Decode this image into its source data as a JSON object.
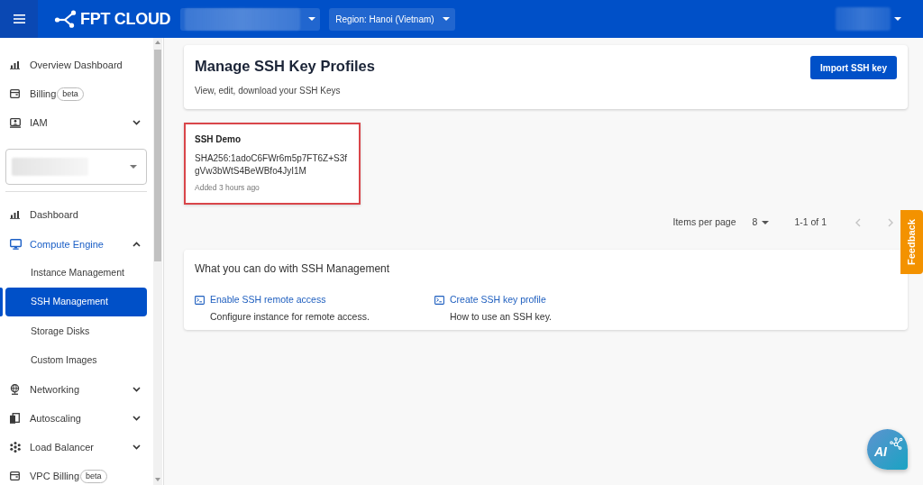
{
  "header": {
    "logo": "FPT CLOUD",
    "region": "Region: Hanoi (Vietnam)"
  },
  "sidebar": {
    "items": [
      {
        "kind": "link",
        "label": "Overview Dashboard",
        "selected": false
      },
      {
        "kind": "link",
        "label": "Billing",
        "badge": "beta",
        "selected": false
      },
      {
        "kind": "group",
        "label": "IAM",
        "expanded": false
      },
      {
        "kind": "select"
      },
      {
        "kind": "link",
        "label": "Dashboard",
        "selected": false
      },
      {
        "kind": "group",
        "label": "Compute Engine",
        "expanded": true,
        "children": [
          {
            "label": "Instance Management",
            "selected": false
          },
          {
            "label": "SSH Management",
            "selected": true
          },
          {
            "label": "Storage Disks",
            "selected": false
          },
          {
            "label": "Custom Images",
            "selected": false
          }
        ]
      },
      {
        "kind": "group",
        "label": "Networking",
        "expanded": false
      },
      {
        "kind": "group",
        "label": "Autoscaling",
        "expanded": false
      },
      {
        "kind": "group",
        "label": "Load Balancer",
        "expanded": false
      },
      {
        "kind": "link",
        "label": "VPC Billing",
        "badge": "beta",
        "selected": false
      }
    ]
  },
  "page_header": {
    "title": "Manage SSH Key Profiles",
    "subtitle": "View, edit, download your SSH Keys",
    "button": "Import SSH key"
  },
  "ssh_keys": [
    {
      "name": "SSH Demo",
      "fingerprint": "SHA256:1adoC6FWr6m5p7FT6Z+S3fgVw3bWtS4BeWBfo4JyI1M",
      "added": "Added 3 hours ago",
      "highlighted": true
    }
  ],
  "pagination": {
    "items_per_page_label": "Items per page",
    "page_size": "8",
    "range": "1-1 of 1",
    "prev_disabled": true,
    "next_disabled": true
  },
  "help_card": {
    "title": "What you can do with SSH Management",
    "links": [
      {
        "label": "Enable SSH remote access",
        "description": "Configure instance for remote access."
      },
      {
        "label": "Create SSH key profile",
        "description": "How to use an SSH key."
      }
    ]
  },
  "feedback_tab": {
    "label": "Feedback"
  },
  "ai_button": {
    "label": "AI"
  }
}
